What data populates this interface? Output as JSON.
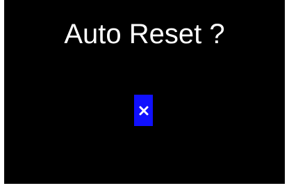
{
  "dialog": {
    "title": "Auto Reset ?",
    "option": {
      "icon": "close-icon",
      "state": "selected",
      "highlight_color": "#1010ff",
      "icon_color": "#ffffff"
    },
    "background_color": "#000000",
    "text_color": "#ffffff"
  }
}
